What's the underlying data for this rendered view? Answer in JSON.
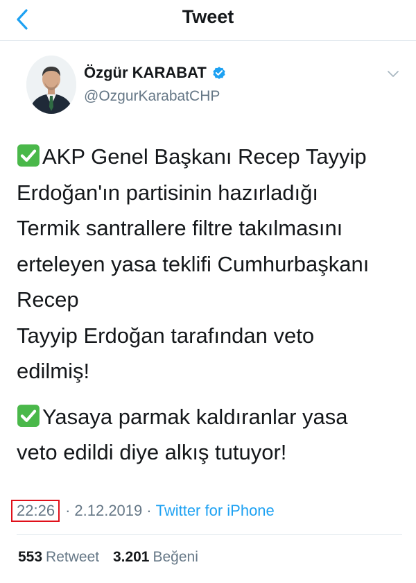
{
  "nav": {
    "title": "Tweet",
    "back_icon": "chevron-left-icon"
  },
  "author": {
    "name": "Özgür KARABAT",
    "handle": "@OzgurKarabatCHP",
    "verified": true,
    "verified_icon": "verified-badge-icon",
    "menu_icon": "chevron-down-icon"
  },
  "tweet": {
    "paragraphs": [
      {
        "check_icon": "check-mark-emoji-icon",
        "lines": [
          "AKP Genel Başkanı Recep Tayyip",
          "Erdoğan'ın partisinin hazırladığı",
          "Termik santrallere filtre takılmasını",
          "erteleyen yasa teklifi Cumhurbaşkanı",
          "Recep",
          "Tayyip Erdoğan tarafından veto",
          "edilmiş!"
        ]
      },
      {
        "check_icon": "check-mark-emoji-icon",
        "lines": [
          "Yasaya parmak kaldıranlar yasa",
          "veto edildi diye alkış tutuyor!"
        ]
      }
    ]
  },
  "meta": {
    "time": "22:26",
    "separator": "·",
    "date": "2.12.2019",
    "source": "Twitter for iPhone",
    "highlight_color": "#e0101a"
  },
  "stats": {
    "retweets_count": "553",
    "retweets_label": "Retweet",
    "likes_count": "3.201",
    "likes_label": "Beğeni"
  },
  "colors": {
    "accent": "#1da1f2",
    "text_primary": "#14171a",
    "text_secondary": "#657786",
    "divider": "#e1e8ed",
    "check_green": "#4ab84a"
  }
}
